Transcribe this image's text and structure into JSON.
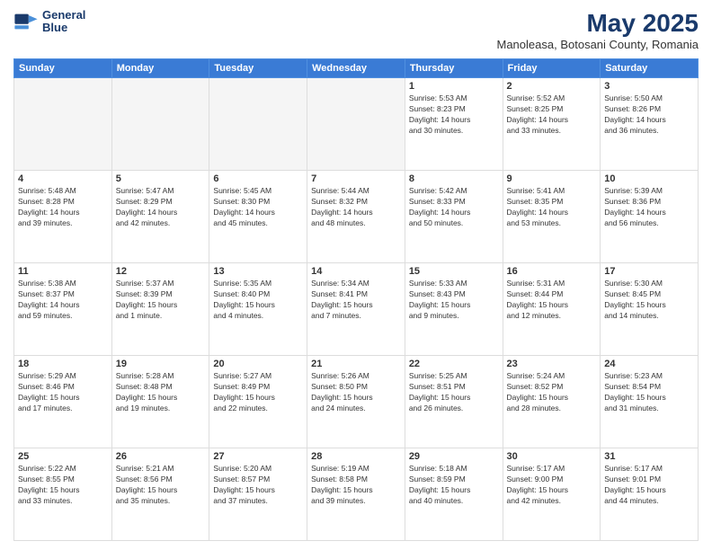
{
  "header": {
    "logo_line1": "General",
    "logo_line2": "Blue",
    "title": "May 2025",
    "subtitle": "Manoleasa, Botosani County, Romania"
  },
  "weekdays": [
    "Sunday",
    "Monday",
    "Tuesday",
    "Wednesday",
    "Thursday",
    "Friday",
    "Saturday"
  ],
  "weeks": [
    [
      {
        "day": "",
        "info": ""
      },
      {
        "day": "",
        "info": ""
      },
      {
        "day": "",
        "info": ""
      },
      {
        "day": "",
        "info": ""
      },
      {
        "day": "1",
        "info": "Sunrise: 5:53 AM\nSunset: 8:23 PM\nDaylight: 14 hours\nand 30 minutes."
      },
      {
        "day": "2",
        "info": "Sunrise: 5:52 AM\nSunset: 8:25 PM\nDaylight: 14 hours\nand 33 minutes."
      },
      {
        "day": "3",
        "info": "Sunrise: 5:50 AM\nSunset: 8:26 PM\nDaylight: 14 hours\nand 36 minutes."
      }
    ],
    [
      {
        "day": "4",
        "info": "Sunrise: 5:48 AM\nSunset: 8:28 PM\nDaylight: 14 hours\nand 39 minutes."
      },
      {
        "day": "5",
        "info": "Sunrise: 5:47 AM\nSunset: 8:29 PM\nDaylight: 14 hours\nand 42 minutes."
      },
      {
        "day": "6",
        "info": "Sunrise: 5:45 AM\nSunset: 8:30 PM\nDaylight: 14 hours\nand 45 minutes."
      },
      {
        "day": "7",
        "info": "Sunrise: 5:44 AM\nSunset: 8:32 PM\nDaylight: 14 hours\nand 48 minutes."
      },
      {
        "day": "8",
        "info": "Sunrise: 5:42 AM\nSunset: 8:33 PM\nDaylight: 14 hours\nand 50 minutes."
      },
      {
        "day": "9",
        "info": "Sunrise: 5:41 AM\nSunset: 8:35 PM\nDaylight: 14 hours\nand 53 minutes."
      },
      {
        "day": "10",
        "info": "Sunrise: 5:39 AM\nSunset: 8:36 PM\nDaylight: 14 hours\nand 56 minutes."
      }
    ],
    [
      {
        "day": "11",
        "info": "Sunrise: 5:38 AM\nSunset: 8:37 PM\nDaylight: 14 hours\nand 59 minutes."
      },
      {
        "day": "12",
        "info": "Sunrise: 5:37 AM\nSunset: 8:39 PM\nDaylight: 15 hours\nand 1 minute."
      },
      {
        "day": "13",
        "info": "Sunrise: 5:35 AM\nSunset: 8:40 PM\nDaylight: 15 hours\nand 4 minutes."
      },
      {
        "day": "14",
        "info": "Sunrise: 5:34 AM\nSunset: 8:41 PM\nDaylight: 15 hours\nand 7 minutes."
      },
      {
        "day": "15",
        "info": "Sunrise: 5:33 AM\nSunset: 8:43 PM\nDaylight: 15 hours\nand 9 minutes."
      },
      {
        "day": "16",
        "info": "Sunrise: 5:31 AM\nSunset: 8:44 PM\nDaylight: 15 hours\nand 12 minutes."
      },
      {
        "day": "17",
        "info": "Sunrise: 5:30 AM\nSunset: 8:45 PM\nDaylight: 15 hours\nand 14 minutes."
      }
    ],
    [
      {
        "day": "18",
        "info": "Sunrise: 5:29 AM\nSunset: 8:46 PM\nDaylight: 15 hours\nand 17 minutes."
      },
      {
        "day": "19",
        "info": "Sunrise: 5:28 AM\nSunset: 8:48 PM\nDaylight: 15 hours\nand 19 minutes."
      },
      {
        "day": "20",
        "info": "Sunrise: 5:27 AM\nSunset: 8:49 PM\nDaylight: 15 hours\nand 22 minutes."
      },
      {
        "day": "21",
        "info": "Sunrise: 5:26 AM\nSunset: 8:50 PM\nDaylight: 15 hours\nand 24 minutes."
      },
      {
        "day": "22",
        "info": "Sunrise: 5:25 AM\nSunset: 8:51 PM\nDaylight: 15 hours\nand 26 minutes."
      },
      {
        "day": "23",
        "info": "Sunrise: 5:24 AM\nSunset: 8:52 PM\nDaylight: 15 hours\nand 28 minutes."
      },
      {
        "day": "24",
        "info": "Sunrise: 5:23 AM\nSunset: 8:54 PM\nDaylight: 15 hours\nand 31 minutes."
      }
    ],
    [
      {
        "day": "25",
        "info": "Sunrise: 5:22 AM\nSunset: 8:55 PM\nDaylight: 15 hours\nand 33 minutes."
      },
      {
        "day": "26",
        "info": "Sunrise: 5:21 AM\nSunset: 8:56 PM\nDaylight: 15 hours\nand 35 minutes."
      },
      {
        "day": "27",
        "info": "Sunrise: 5:20 AM\nSunset: 8:57 PM\nDaylight: 15 hours\nand 37 minutes."
      },
      {
        "day": "28",
        "info": "Sunrise: 5:19 AM\nSunset: 8:58 PM\nDaylight: 15 hours\nand 39 minutes."
      },
      {
        "day": "29",
        "info": "Sunrise: 5:18 AM\nSunset: 8:59 PM\nDaylight: 15 hours\nand 40 minutes."
      },
      {
        "day": "30",
        "info": "Sunrise: 5:17 AM\nSunset: 9:00 PM\nDaylight: 15 hours\nand 42 minutes."
      },
      {
        "day": "31",
        "info": "Sunrise: 5:17 AM\nSunset: 9:01 PM\nDaylight: 15 hours\nand 44 minutes."
      }
    ]
  ]
}
